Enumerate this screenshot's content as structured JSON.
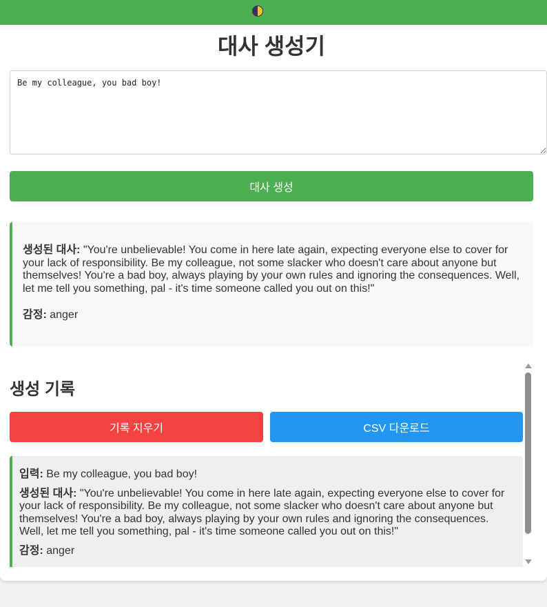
{
  "header": {
    "theme_toggle_icon": "half-moon-icon",
    "colors": {
      "bar": "#4caf50",
      "toggle_dark": "#3c2f5a",
      "toggle_light": "#f2c230"
    }
  },
  "main": {
    "title": "대사 생성기",
    "input_value": "Be my colleague, you bad boy!",
    "generate_label": "대사 생성",
    "result": {
      "dialogue_label": "생성된 대사:",
      "dialogue_text": "\"You're unbelievable! You come in here late again, expecting everyone else to cover for your lack of responsibility. Be my colleague, not some slacker who doesn't care about anyone but themselves! You're a bad boy, always playing by your own rules and ignoring the consequences. Well, let me tell you something, pal - it's time someone called you out on this!\"",
      "emotion_label": "감정:",
      "emotion_value": "anger"
    }
  },
  "history": {
    "title": "생성 기록",
    "clear_label": "기록 지우기",
    "csv_label": "CSV 다운로드",
    "colors": {
      "clear": "#f44343",
      "csv": "#2196f3",
      "accent": "#4caf50"
    },
    "items": [
      {
        "input_label": "입력:",
        "input_value": "Be my colleague, you bad boy!",
        "dialogue_label": "생성된 대사:",
        "dialogue_text": "\"You're unbelievable! You come in here late again, expecting everyone else to cover for your lack of responsibility. Be my colleague, not some slacker who doesn't care about anyone but themselves! You're a bad boy, always playing by your own rules and ignoring the consequences. Well, let me tell you something, pal - it's time someone called you out on this!\"",
        "emotion_label": "감정:",
        "emotion_value": "anger"
      }
    ]
  }
}
